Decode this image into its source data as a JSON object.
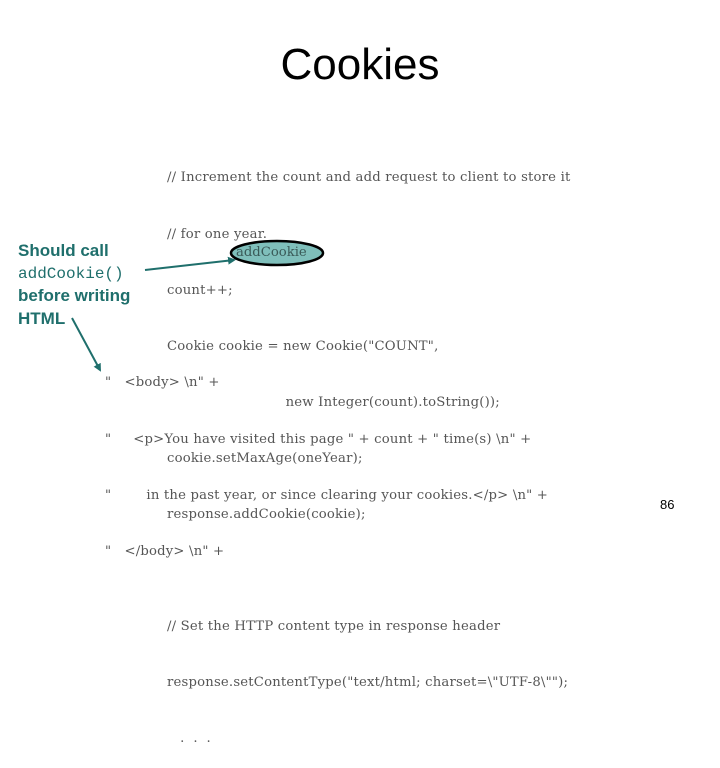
{
  "slide": {
    "title": "Cookies",
    "page_number": "86",
    "annotation": {
      "line1": "Should call",
      "line2": "addCookie()",
      "line3": "before writing",
      "line4": "HTML",
      "color": "#1f6f6c"
    },
    "highlight": {
      "text": "addCookie",
      "fill": "#7fbfbb",
      "stroke": "#000000"
    },
    "code_block_1": [
      "// Increment the count and add request to client to store it",
      "// for one year.",
      "count++;",
      "Cookie cookie = new Cookie(\"COUNT\",",
      "                           new Integer(count).toString());",
      "cookie.setMaxAge(oneYear);",
      "response.addCookie(cookie);",
      "",
      "// Set the HTTP content type in response header",
      "response.setContentType(\"text/html; charset=\\\"UTF-8\\\"\");",
      "   .  .  ."
    ],
    "code_block_2": [
      "\"   <body> \\n\" +",
      "\"     <p>You have visited this page \" + count + \" time(s) \\n\" +",
      "\"        in the past year, or since clearing your cookies.</p> \\n\" +",
      "\"   </body> \\n\" +"
    ]
  }
}
